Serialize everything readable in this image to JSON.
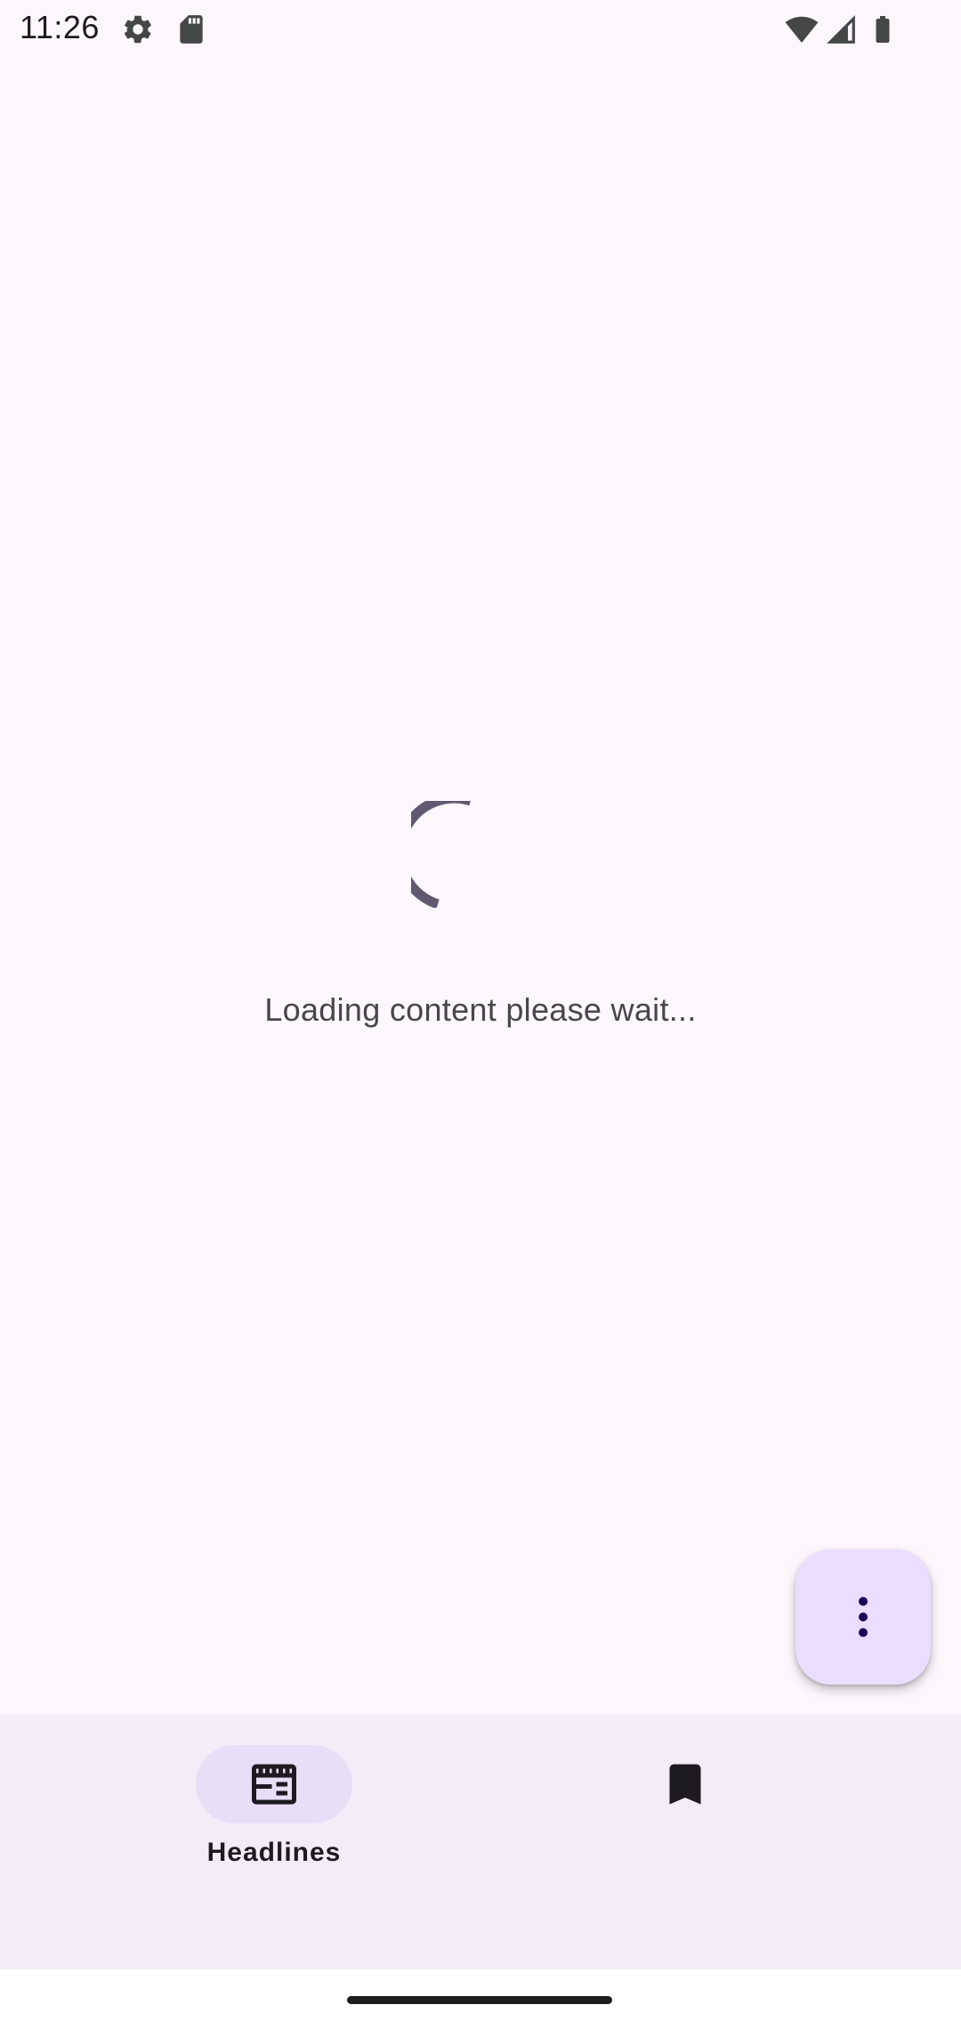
{
  "status_bar": {
    "time": "11:26",
    "icons": [
      "settings-icon",
      "sd-card-icon",
      "wifi-icon",
      "cellular-signal-icon",
      "battery-icon"
    ]
  },
  "main": {
    "loading_text": "Loading content please wait..."
  },
  "fab": {
    "icon": "more-vertical-icon"
  },
  "bottom_nav": {
    "items": [
      {
        "label": "Headlines",
        "icon": "newspaper-icon",
        "selected": true
      },
      {
        "icon": "bookmark-icon",
        "selected": false
      }
    ]
  },
  "colors": {
    "background": "#fdf7fd",
    "nav_background": "#f3edf7",
    "nav_indicator": "#e8def8",
    "fab_background": "#eaddff",
    "spinner": "#5f5a71",
    "icon_dark": "#1d1b20"
  }
}
